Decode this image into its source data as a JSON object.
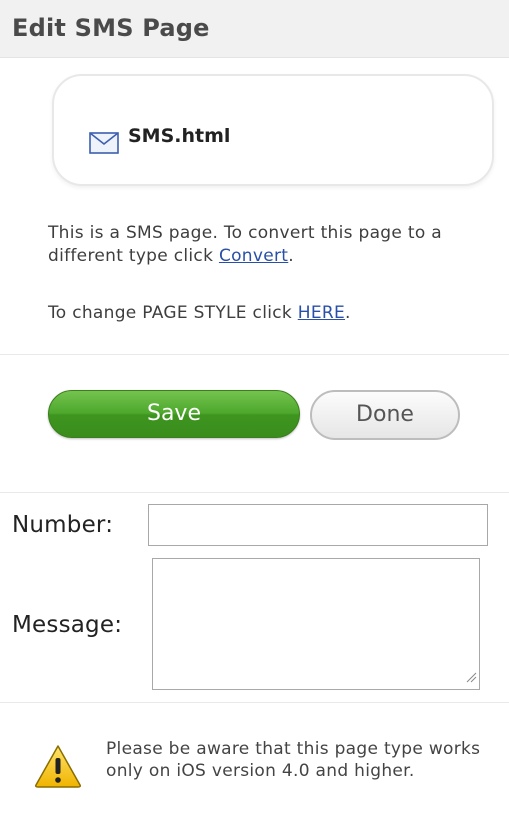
{
  "header": {
    "title": "Edit SMS Page"
  },
  "file_card": {
    "icon": "envelope-icon",
    "file_name": "SMS.html"
  },
  "info": {
    "convert_text_before": "This is a SMS page. To convert this page to a different type click ",
    "convert_link": "Convert",
    "convert_text_after": ".",
    "style_text_before": "To change PAGE STYLE click ",
    "style_link": "HERE",
    "style_text_after": "."
  },
  "buttons": {
    "save_label": "Save",
    "done_label": "Done"
  },
  "form": {
    "number_label": "Number:",
    "number_value": "",
    "message_label": "Message:",
    "message_value": ""
  },
  "notice": {
    "icon": "warning-icon",
    "text": "Please be aware that this page type works only on iOS version 4.0 and higher."
  },
  "colors": {
    "save_green": "#4da82c",
    "link_blue": "#2a4fa8",
    "warning_yellow": "#f2c21a"
  }
}
